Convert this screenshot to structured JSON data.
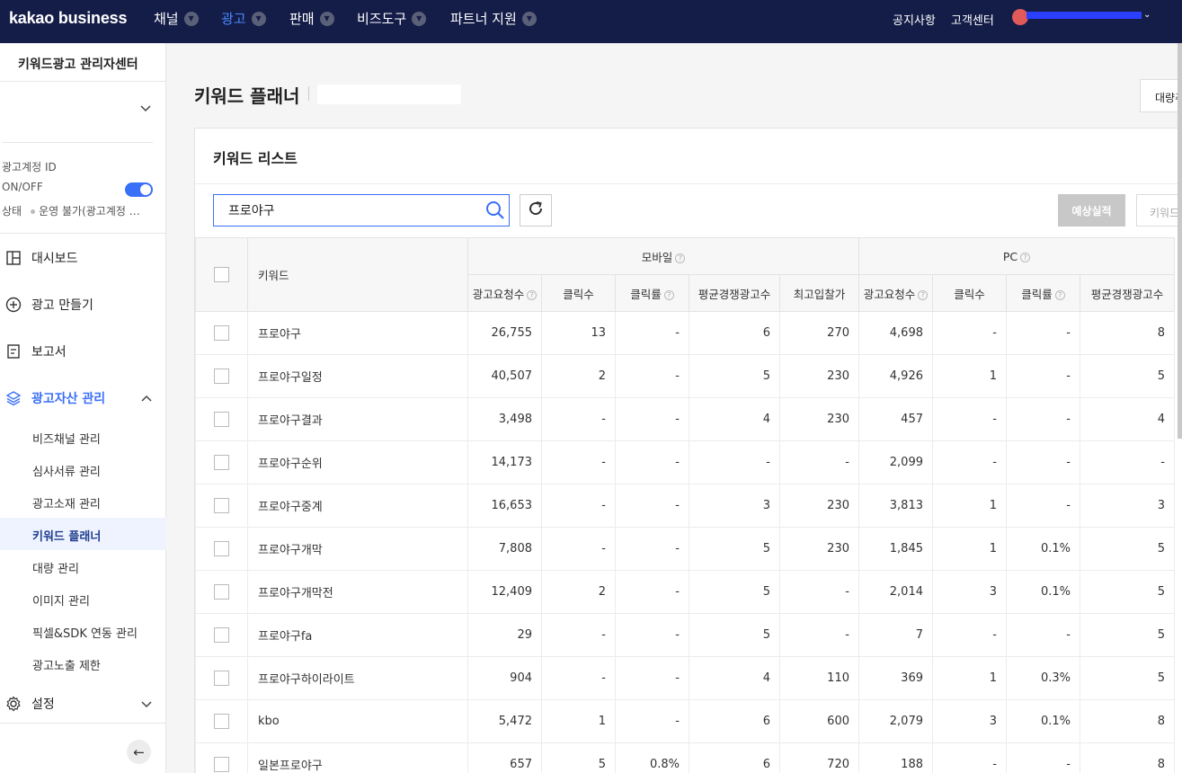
{
  "topnav": {
    "brand": "kakao business",
    "menus": [
      {
        "label": "채널",
        "active": false
      },
      {
        "label": "광고",
        "active": true
      },
      {
        "label": "판매",
        "active": false
      },
      {
        "label": "비즈도구",
        "active": false
      },
      {
        "label": "파트너 지원",
        "active": false
      }
    ],
    "notice": "공지사항",
    "support": "고객센터"
  },
  "sidebar": {
    "title": "키워드광고 관리자센터",
    "account_id_label": "광고계정 ID",
    "onoff_label": "ON/OFF",
    "status_label": "상태",
    "status_value": "운영 불가(광고계정 …",
    "nav": [
      {
        "label": "대시보드",
        "icon": "dashboard-icon"
      },
      {
        "label": "광고 만들기",
        "icon": "plus-circle-icon"
      },
      {
        "label": "보고서",
        "icon": "report-icon"
      },
      {
        "label": "광고자산 관리",
        "icon": "layers-icon"
      },
      {
        "label": "설정",
        "icon": "gear-icon"
      }
    ],
    "sub_items": [
      "비즈채널 관리",
      "심사서류 관리",
      "광고소재 관리",
      "키워드 플래너",
      "대량 관리",
      "이미지 관리",
      "픽셀&SDK 연동 관리",
      "광고노출 제한"
    ]
  },
  "main": {
    "title": "키워드 플래너",
    "bulk_button": "대량추가",
    "card_title": "키워드 리스트",
    "search_value": "프로야구",
    "estimate_button": "예상실적",
    "keyword_button": "키워드 추가"
  },
  "table": {
    "col_keyword": "키워드",
    "group_mobile": "모바일",
    "group_pc": "PC",
    "sub_headers": [
      "광고요청수",
      "클릭수",
      "클릭률",
      "평균경쟁광고수",
      "최고입찰가"
    ],
    "rows": [
      {
        "kw": "프로야구",
        "m": [
          "26,755",
          "13",
          "-",
          "6",
          "270"
        ],
        "p": [
          "4,698",
          "-",
          "-",
          "8"
        ]
      },
      {
        "kw": "프로야구일정",
        "m": [
          "40,507",
          "2",
          "-",
          "5",
          "230"
        ],
        "p": [
          "4,926",
          "1",
          "-",
          "5"
        ]
      },
      {
        "kw": "프로야구결과",
        "m": [
          "3,498",
          "-",
          "-",
          "4",
          "230"
        ],
        "p": [
          "457",
          "-",
          "-",
          "4"
        ]
      },
      {
        "kw": "프로야구순위",
        "m": [
          "14,173",
          "-",
          "-",
          "-",
          "-"
        ],
        "p": [
          "2,099",
          "-",
          "-",
          "-"
        ]
      },
      {
        "kw": "프로야구중계",
        "m": [
          "16,653",
          "-",
          "-",
          "3",
          "230"
        ],
        "p": [
          "3,813",
          "1",
          "-",
          "3"
        ]
      },
      {
        "kw": "프로야구개막",
        "m": [
          "7,808",
          "-",
          "-",
          "5",
          "230"
        ],
        "p": [
          "1,845",
          "1",
          "0.1%",
          "5"
        ]
      },
      {
        "kw": "프로야구개막전",
        "m": [
          "12,409",
          "2",
          "-",
          "5",
          "-"
        ],
        "p": [
          "2,014",
          "3",
          "0.1%",
          "5"
        ]
      },
      {
        "kw": "프로야구fa",
        "m": [
          "29",
          "-",
          "-",
          "5",
          "-"
        ],
        "p": [
          "7",
          "-",
          "-",
          "5"
        ]
      },
      {
        "kw": "프로야구하이라이트",
        "m": [
          "904",
          "-",
          "-",
          "4",
          "110"
        ],
        "p": [
          "369",
          "1",
          "0.3%",
          "5"
        ]
      },
      {
        "kw": "kbo",
        "m": [
          "5,472",
          "1",
          "-",
          "6",
          "600"
        ],
        "p": [
          "2,079",
          "3",
          "0.1%",
          "8"
        ]
      },
      {
        "kw": "일본프로야구",
        "m": [
          "657",
          "5",
          "0.8%",
          "6",
          "720"
        ],
        "p": [
          "188",
          "-",
          "-",
          "8"
        ]
      }
    ]
  }
}
